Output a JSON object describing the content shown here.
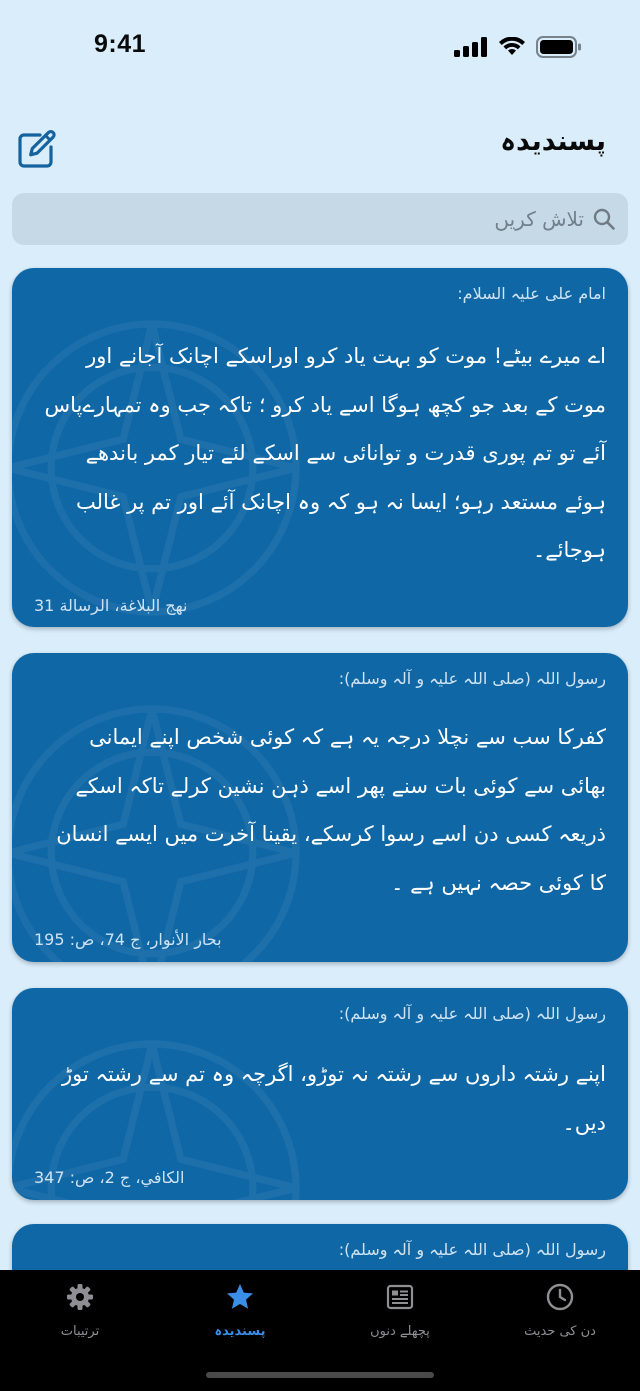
{
  "status_bar": {
    "time": "9:41"
  },
  "header": {
    "title": "پسندیدہ"
  },
  "search": {
    "placeholder": "تلاش کریں",
    "value": ""
  },
  "cards": [
    {
      "narrator": "امام علی علیہ السلام:",
      "text": "اے میرے بیٹے! موت کو بہت یاد کرو اوراسکے اچانک آجانے اور موت کے بعد جو کچھ ہوگا اسے یاد کرو ؛ تاکہ جب وہ تمہارےپاس آئے تو تم پوری قدرت و توانائی سے اسکے لئے تیار کمر باندھے ہوئے مستعد رہو؛ ایسا نہ ہو کہ وہ اچانک آئے اور تم پر غالب ہوجائے۔",
      "source": "نهج البلاغة، الرسالة 31"
    },
    {
      "narrator": "رسول اللہ (صلی اللہ علیہ و آلہ وسلم):",
      "text": "کفرکا سب سے نچلا درجہ یہ ہے کہ کوئی شخص اپنے ایمانی بھائی سے کوئی بات سنے پھر اسے ذہن نشین کرلے تاکہ اسکے ذریعہ کسی دن اسے رسوا کرسکے، یقینا آخرت میں ایسے انسان کا کوئی حصہ نہیں ہے ۔",
      "source": "بحار الأنوار، ج 74، ص: 195"
    },
    {
      "narrator": "رسول اللہ (صلی اللہ علیہ و آلہ وسلم):",
      "text": "اپنے رشتہ داروں سے رشتہ نہ توڑو، اگرچہ وہ تم سے رشتہ توڑ دیں۔",
      "source": "الكافي، ج 2، ص: 347"
    },
    {
      "narrator": "رسول اللہ (صلی اللہ علیہ و آلہ وسلم):"
    }
  ],
  "tabs": [
    {
      "label": "ترتیبات",
      "icon": "gear-icon"
    },
    {
      "label": "پسندیدہ",
      "icon": "star-icon",
      "active": true
    },
    {
      "label": "پچھلے دنوں",
      "icon": "news-icon"
    },
    {
      "label": "دن کی حدیث",
      "icon": "clock-icon"
    }
  ],
  "colors": {
    "background": "#d9edfb",
    "card": "#0f67a6",
    "accent": "#3a8ee8",
    "tab_bar": "#000000",
    "search_bg": "#c6d9e6"
  }
}
